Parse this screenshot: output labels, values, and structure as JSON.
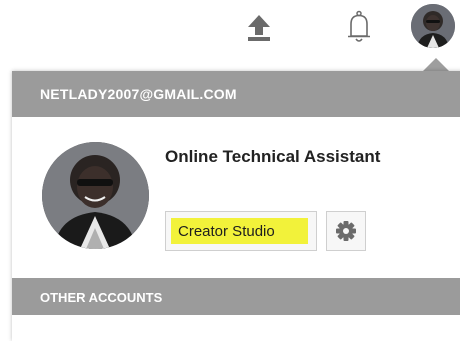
{
  "header": {
    "upload_icon": "upload-icon",
    "notifications_icon": "bell-icon",
    "avatar_icon": "user-avatar"
  },
  "account_menu": {
    "email": "NETLADY2007@GMAIL.COM",
    "account_name": "Online Technical Assistant",
    "creator_studio_label": "Creator Studio",
    "settings_icon": "gear-icon",
    "other_accounts_label": "OTHER ACCOUNTS"
  },
  "colors": {
    "section_bar": "#9b9b9b",
    "highlight": "#f2f23a",
    "icon_gray": "#6b6b6b"
  }
}
